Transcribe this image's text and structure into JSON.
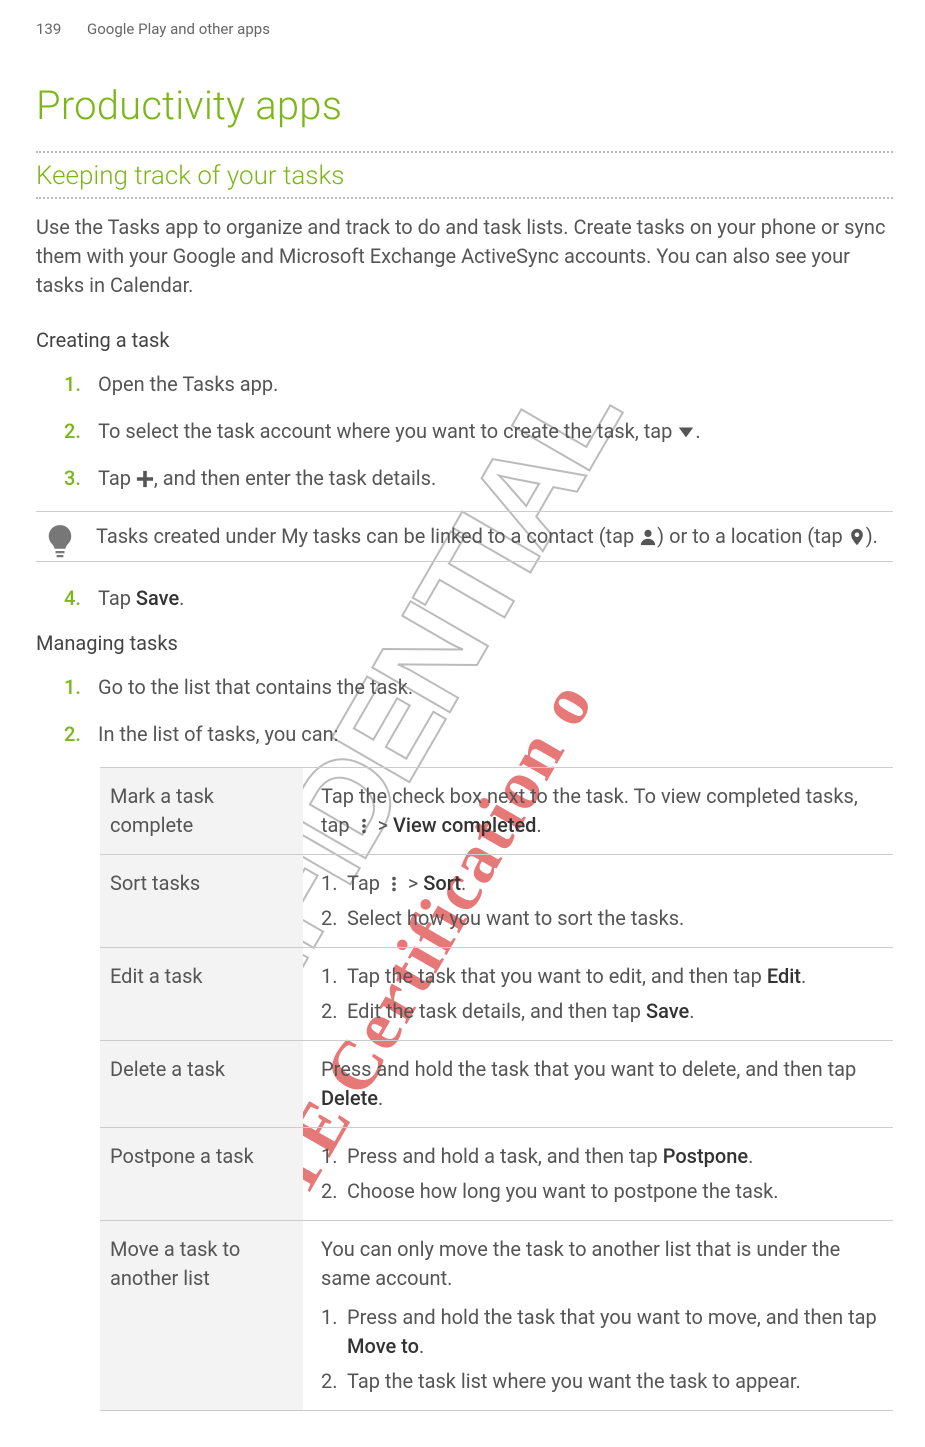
{
  "header": {
    "page_number": "139",
    "section": "Google Play and other apps"
  },
  "title": "Productivity apps",
  "subtitle": "Keeping track of your tasks",
  "intro": "Use the Tasks app to organize and track to do and task lists. Create tasks on your phone or sync them with your Google and Microsoft Exchange ActiveSync accounts. You can also see your tasks in Calendar.",
  "create": {
    "heading": "Creating a task",
    "s1": "Open the Tasks app.",
    "s2a": "To select the task account where you want to create the task, tap ",
    "s2b": ".",
    "s3a": "Tap ",
    "s3b": ", and then enter the task details.",
    "tip_a": "Tasks created under My tasks can be linked to a contact (tap ",
    "tip_b": ") or to a location (tap ",
    "tip_c": ").",
    "s4a": "Tap ",
    "s4_save": "Save",
    "s4b": "."
  },
  "manage": {
    "heading": "Managing tasks",
    "s1": "Go to the list that contains the task.",
    "s2": "In the list of tasks, you can:"
  },
  "table": {
    "r1": {
      "k": "Mark a task complete",
      "va": "Tap the check box next to the task. To view completed tasks, tap ",
      "vb": " > ",
      "vc": "View completed",
      "vd": "."
    },
    "r2": {
      "k": "Sort tasks",
      "l1a": "Tap ",
      "l1b": " > ",
      "l1c": "Sort",
      "l1d": ".",
      "l2": "Select how you want to sort the tasks."
    },
    "r3": {
      "k": "Edit a task",
      "l1a": "Tap the task that you want to edit, and then tap ",
      "l1b": "Edit",
      "l1c": ".",
      "l2a": "Edit the task details, and then tap ",
      "l2b": "Save",
      "l2c": "."
    },
    "r4": {
      "k": "Delete a task",
      "va": "Press and hold the task that you want to delete, and then tap ",
      "vb": "Delete",
      "vc": "."
    },
    "r5": {
      "k": "Postpone a task",
      "l1a": "Press and hold a task, and then tap ",
      "l1b": "Postpone",
      "l1c": ".",
      "l2": "Choose how long you want to postpone the task."
    },
    "r6": {
      "k": "Move a task to another list",
      "p": "You can only move the task to another list that is under the same account.",
      "l1a": "Press and hold the task that you want to move, and then tap ",
      "l1b": "Move to",
      "l1c": ".",
      "l2": "Tap the task list where you want the task to appear."
    }
  },
  "watermark": {
    "conf": "CONFIDENTIAL",
    "cert": "R&TTE Certification o"
  }
}
